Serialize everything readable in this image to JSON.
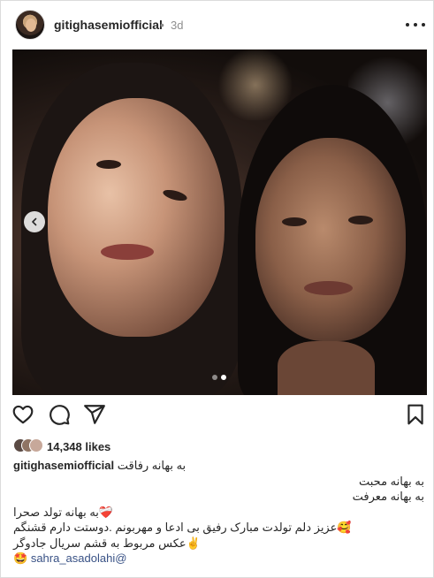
{
  "header": {
    "username": "gitighasemiofficial",
    "separator": "•",
    "time": "3d"
  },
  "carousel": {
    "total": 2,
    "active": 2
  },
  "likes": {
    "count_label": "14,348 likes"
  },
  "caption": {
    "username": "gitighasemiofficial",
    "lines": [
      "به بهانه رفاقت",
      "به بهانه محبت",
      "به بهانه معرفت",
      "به بهانه تولد صحرا",
      "عزیز دلم تولدت مبارک رفیق بی ادعا و مهربونم .دوستت دارم قشنگم",
      "عکس مربوط به قشم سریال جادوگر",
      "sahra_asadolahi@"
    ],
    "emojis": {
      "line4": "❤️‍🩹",
      "line5": "🥰",
      "line6": "✌️",
      "line7": "🤩"
    }
  },
  "icons": {
    "heart": "heart-icon",
    "comment": "comment-icon",
    "share": "share-icon",
    "save": "bookmark-icon",
    "more": "more-icon",
    "prev": "chevron-left-icon"
  }
}
